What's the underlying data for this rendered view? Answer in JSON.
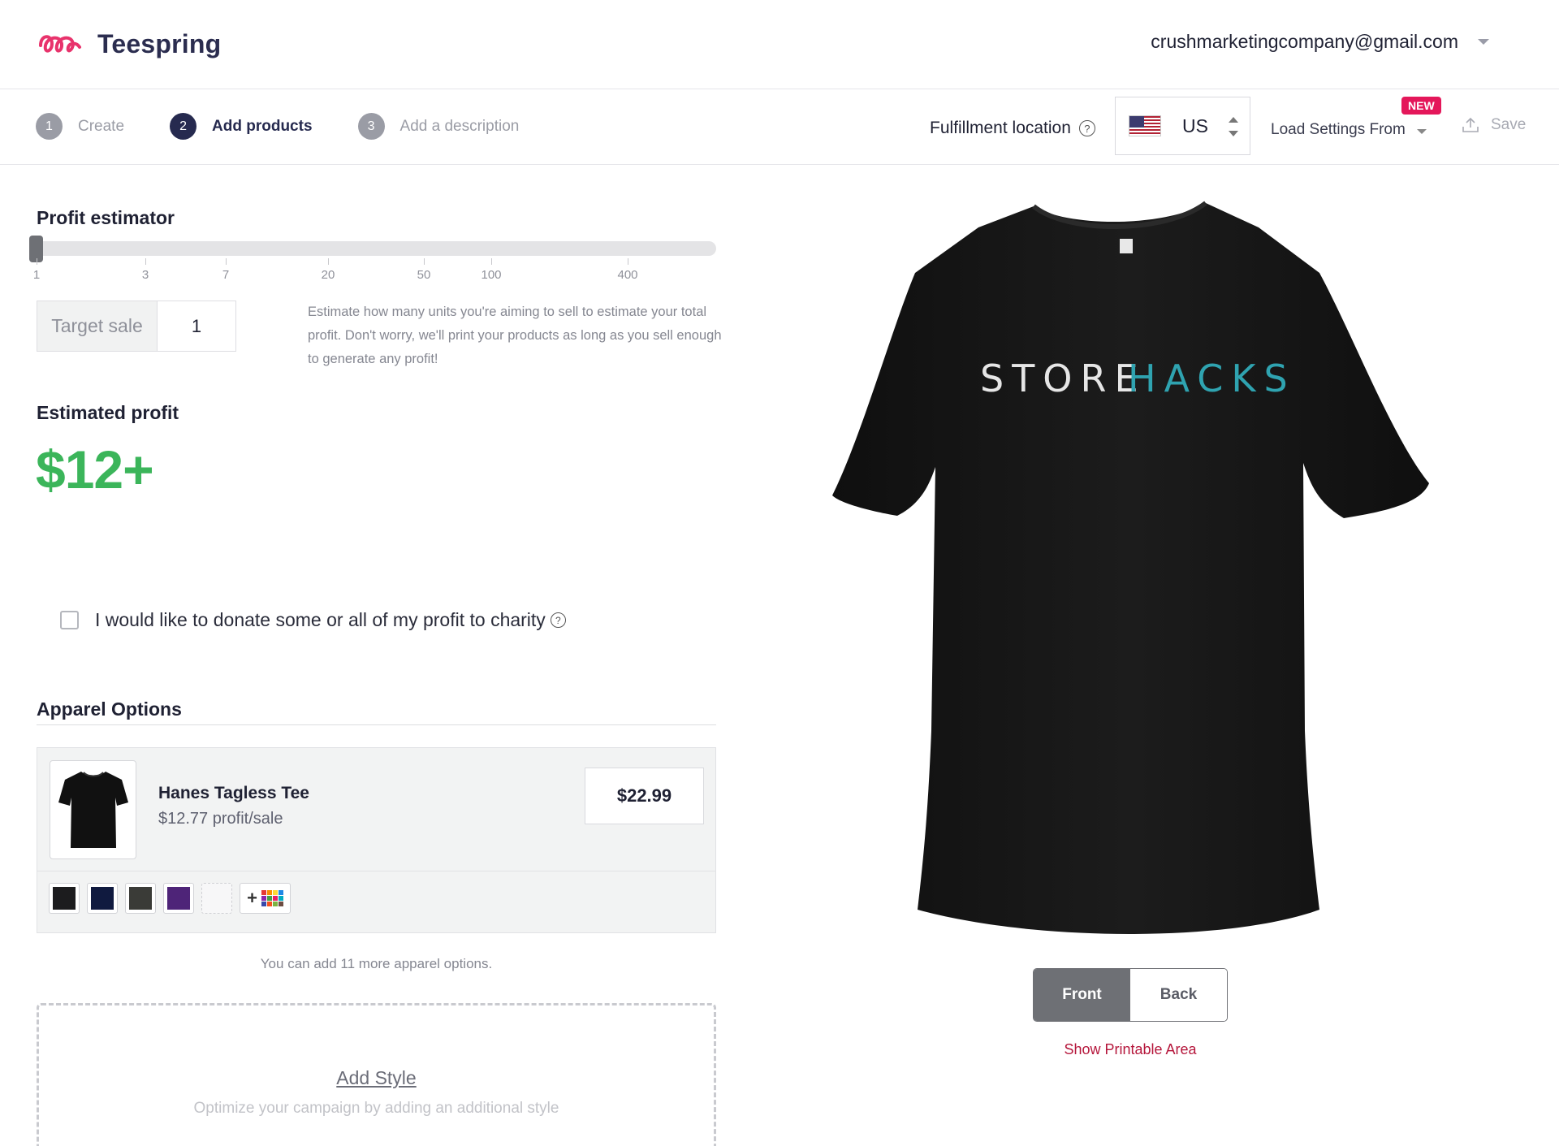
{
  "header": {
    "brand": "Teespring",
    "account_email": "crushmarketingcompany@gmail.com"
  },
  "steps": [
    {
      "number": "1",
      "label": "Create",
      "state": "inactive"
    },
    {
      "number": "2",
      "label": "Add products",
      "state": "active"
    },
    {
      "number": "3",
      "label": "Add a description",
      "state": "inactive"
    }
  ],
  "toolbar": {
    "fulfillment_label": "Fulfillment location",
    "country_code": "US",
    "load_settings_label": "Load Settings From",
    "new_badge": "NEW",
    "save_label": "Save"
  },
  "profit_estimator": {
    "title": "Profit estimator",
    "slider_value": 1,
    "ticks": [
      "1",
      "3",
      "7",
      "20",
      "50",
      "100",
      "400"
    ],
    "target_label": "Target sale",
    "target_value": "1",
    "help_text": "Estimate how many units you're aiming to sell to estimate your total profit. Don't worry, we'll print your products as long as you sell enough to generate any profit!"
  },
  "estimated_profit": {
    "title": "Estimated profit",
    "value": "$12+"
  },
  "charity": {
    "label": "I would like to donate some or all of my profit to charity",
    "checked": false
  },
  "apparel": {
    "title": "Apparel Options",
    "product_name": "Hanes Tagless Tee",
    "profit_per_sale": "$12.77 profit/sale",
    "price": "$22.99",
    "colors": [
      "#1c1c1e",
      "#101a3f",
      "#3a3b37",
      "#4e2478"
    ],
    "more_options_text": "You can add 11 more apparel options.",
    "add_style_link": "Add Style",
    "add_style_sub": "Optimize your campaign by adding an additional style"
  },
  "preview": {
    "design_text_part1": "STORE",
    "design_text_part2": "HACKS",
    "front_label": "Front",
    "back_label": "Back",
    "printable_link": "Show Printable Area",
    "shirt_color": "#171717",
    "accent_teal": "#2fa3b0"
  },
  "colors": {
    "brand_pink": "#e8336c",
    "brand_navy": "#2b2d4f",
    "profit_green": "#3bb55a",
    "link_red": "#b5163b"
  }
}
